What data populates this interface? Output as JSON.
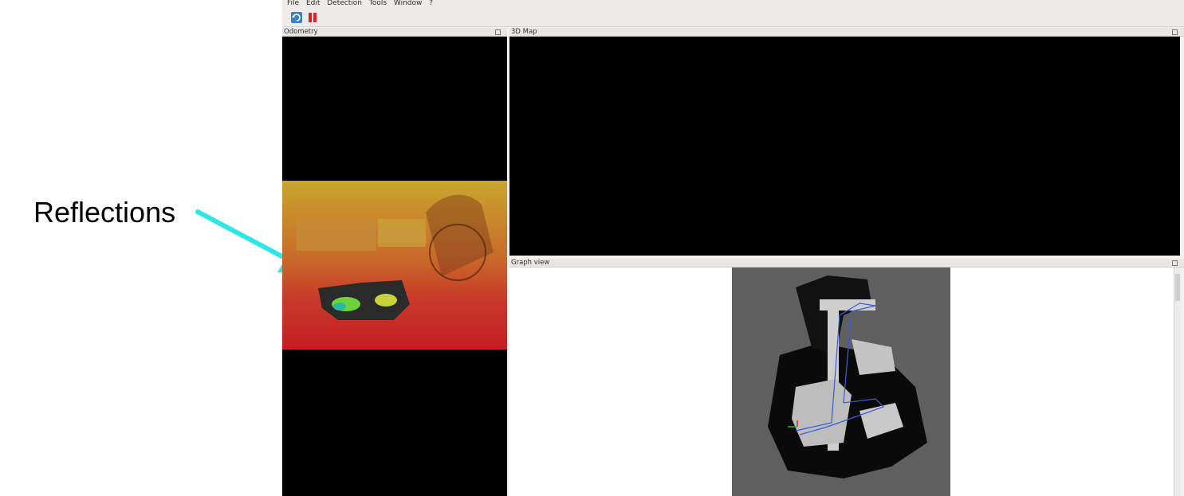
{
  "annotation": {
    "label": "Reflections",
    "arrow_color": "#2ee6e6"
  },
  "menu": [
    "File",
    "Edit",
    "Detection",
    "Tools",
    "Window",
    "?"
  ],
  "toolbar": {
    "icons": [
      "refresh-icon",
      "pause-icon"
    ]
  },
  "docks": {
    "odometry": {
      "title": "Odometry"
    },
    "map3d": {
      "title": "3D Map"
    },
    "graph": {
      "title": "Graph view"
    }
  }
}
